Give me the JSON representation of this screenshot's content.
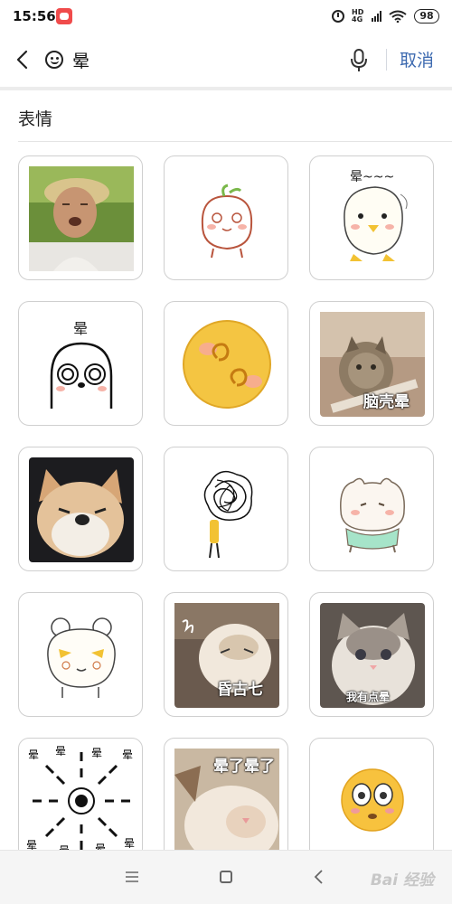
{
  "status_bar": {
    "time": "15:56",
    "network": "HD 4G",
    "battery": "98"
  },
  "search": {
    "query": "晕",
    "cancel_label": "取消"
  },
  "section": {
    "title": "表情"
  },
  "stickers": [
    {
      "caption": ""
    },
    {
      "caption": ""
    },
    {
      "caption": "晕~~~"
    },
    {
      "caption": "晕"
    },
    {
      "caption": ""
    },
    {
      "caption": "脑壳晕"
    },
    {
      "caption": ""
    },
    {
      "caption": ""
    },
    {
      "caption": ""
    },
    {
      "caption": ""
    },
    {
      "caption": "昏古七"
    },
    {
      "caption": "我有点晕"
    },
    {
      "caption": ""
    },
    {
      "caption": "晕了晕了"
    },
    {
      "caption": ""
    }
  ],
  "watermark": "Bai 经验",
  "colors": {
    "accent": "#3d6ab0",
    "cell_border": "#cfcfcf",
    "emoji_yellow": "#f4c542"
  }
}
